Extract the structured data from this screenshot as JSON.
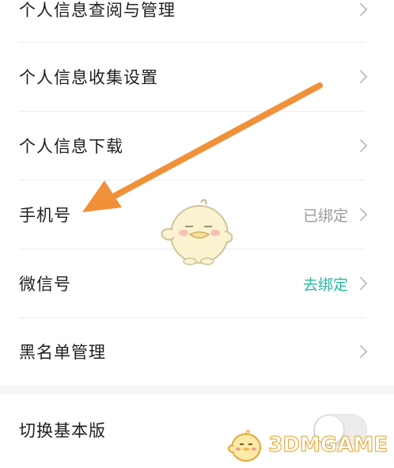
{
  "settings": {
    "items": [
      {
        "label": "个人信息查阅与管理",
        "value": ""
      },
      {
        "label": "个人信息收集设置",
        "value": ""
      },
      {
        "label": "个人信息下载",
        "value": ""
      },
      {
        "label": "手机号",
        "value": "已绑定"
      },
      {
        "label": "微信号",
        "value": "去绑定"
      },
      {
        "label": "黑名单管理",
        "value": ""
      }
    ],
    "switch_item": {
      "label": "切换基本版",
      "state": "off"
    }
  },
  "watermark": {
    "text": "3DMGAME"
  },
  "colors": {
    "accent": "#2bb3a2",
    "annotation_arrow": "#f0913a",
    "watermark": "#f4c35a"
  }
}
